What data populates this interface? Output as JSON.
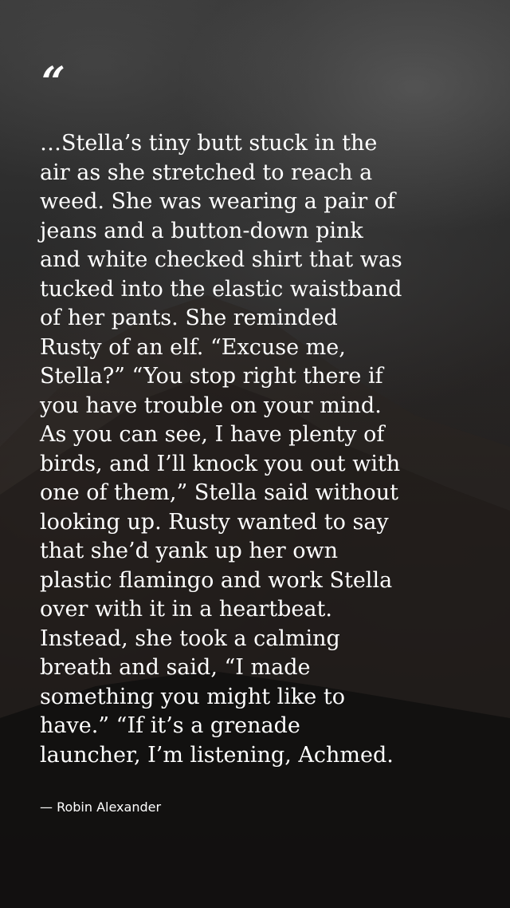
{
  "quote": {
    "mark": "“",
    "lines": [
      "…Stella’s tiny butt stuck in the",
      "air as she stretched to reach a",
      "weed. She was wearing a pair of",
      "jeans and a button-down pink",
      "and white checked shirt that was",
      "tucked into the elastic waistband",
      "of her pants. She reminded",
      "Rusty of an elf. “Excuse me,",
      "Stella?” “You stop right there if",
      "you have trouble on your mind.",
      "As you can see, I have plenty of",
      "birds, and I’ll knock you out with",
      "one of them,” Stella said without",
      "looking up. Rusty wanted to say",
      "that she’d yank up her own",
      "plastic flamingo and work Stella",
      "over with it in a heartbeat.",
      "Instead, she took a calming",
      "breath and said, “I made",
      "something you might like to",
      "have.” “If it’s a grenade",
      "launcher, I’m listening, Achmed."
    ],
    "author": "— Robin Alexander"
  },
  "colors": {
    "text": "#ffffff",
    "background": "#1b1b1b"
  }
}
